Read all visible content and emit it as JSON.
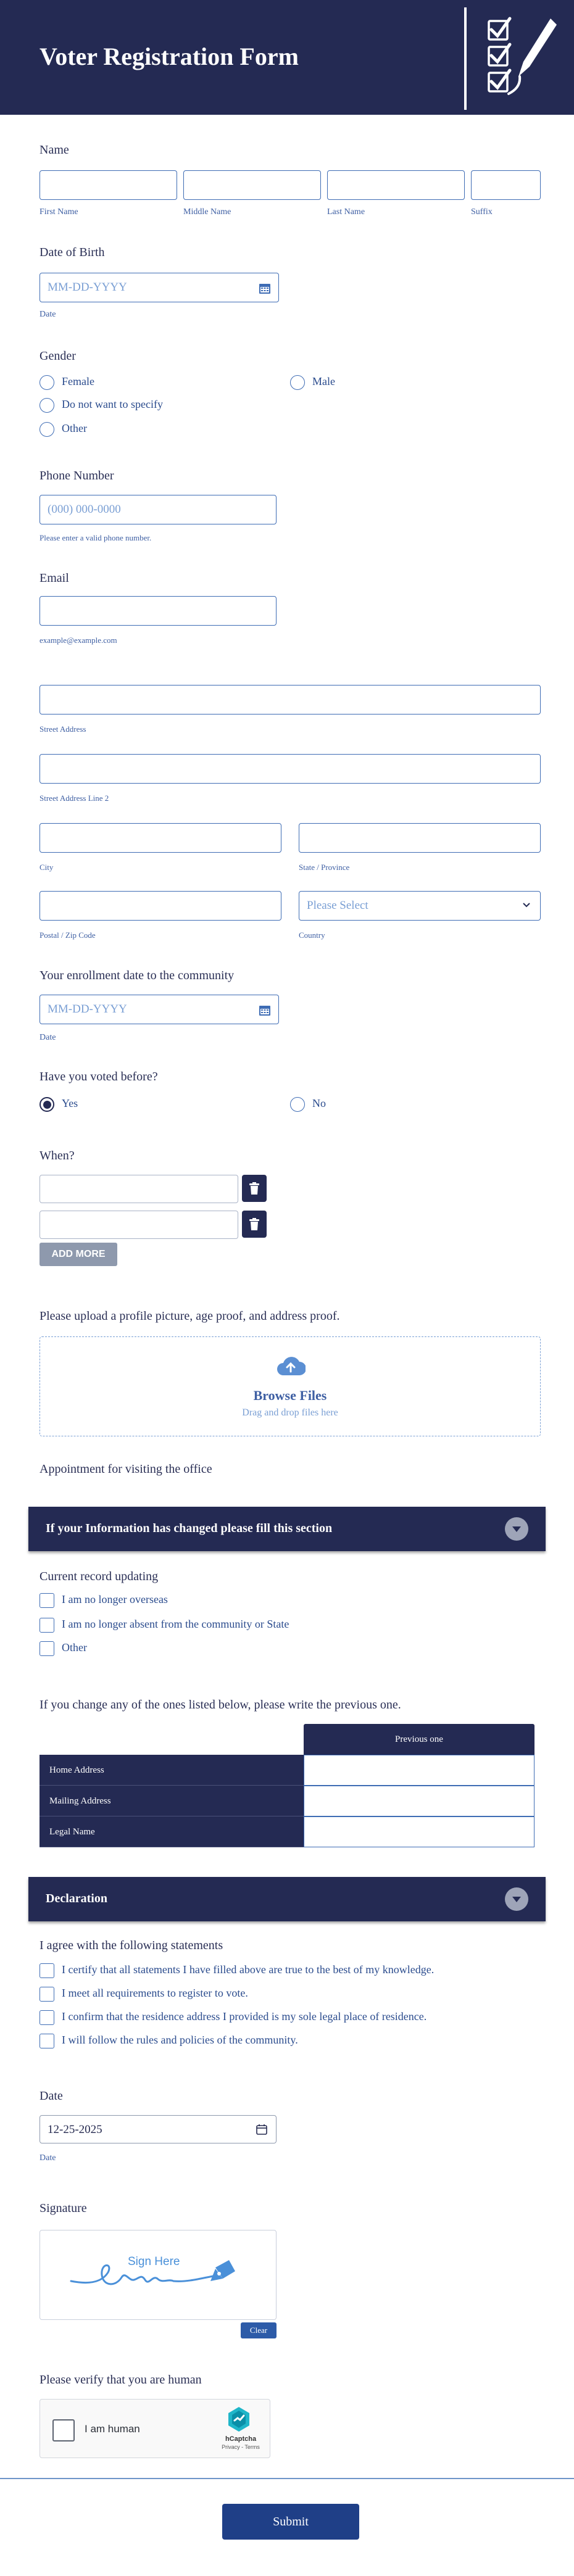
{
  "header": {
    "title": "Voter Registration Form",
    "logo": "checklist-pen-icon"
  },
  "name": {
    "label": "Name",
    "first": "First Name",
    "middle": "Middle Name",
    "last": "Last Name",
    "suffix": "Suffix"
  },
  "dob": {
    "label": "Date of Birth",
    "placeholder": "MM-DD-YYYY",
    "sublabel": "Date"
  },
  "gender": {
    "label": "Gender",
    "options": [
      "Female",
      "Male",
      "Do not want to specify",
      "Other"
    ]
  },
  "phone": {
    "label": "Phone Number",
    "placeholder": "(000) 000-0000",
    "sublabel": "Please enter a valid phone number."
  },
  "email": {
    "label": "Email",
    "sublabel": "example@example.com"
  },
  "address": {
    "street": "Street Address",
    "street2": "Street Address Line 2",
    "city": "City",
    "state": "State / Province",
    "postal": "Postal / Zip Code",
    "country": "Country",
    "country_placeholder": "Please Select"
  },
  "enrollment": {
    "label": "Your enrollment date to the community",
    "placeholder": "MM-DD-YYYY",
    "sublabel": "Date"
  },
  "voted": {
    "label": "Have you voted before?",
    "options": [
      "Yes",
      "No"
    ],
    "selected": "Yes"
  },
  "when": {
    "label": "When?",
    "add_more": "ADD MORE"
  },
  "upload": {
    "label": "Please upload a profile picture, age proof, and address proof.",
    "browse": "Browse Files",
    "hint": "Drag and drop files here"
  },
  "appointment": {
    "label": "Appointment for visiting the office"
  },
  "changed_section": {
    "title": "If your Information has changed please fill this section",
    "record_label": "Current record updating",
    "record_options": [
      "I am no longer overseas",
      "I am no longer absent from the community or State",
      "Other"
    ],
    "change_label": "If you change any of the ones listed below, please write the previous one.",
    "column": "Previous one",
    "rows": [
      "Home Address",
      "Mailing Address",
      "Legal Name"
    ]
  },
  "declaration": {
    "title": "Declaration",
    "statements_label": "I agree with the following statements",
    "statements": [
      "I certify that all statements I have filled above are true to the best of my knowledge.",
      "I meet all requirements to register to vote.",
      "I confirm that the residence address I provided is my sole legal place of residence.",
      "I will follow the rules and policies of the community."
    ]
  },
  "date": {
    "label": "Date",
    "value": "12-25-2025",
    "sublabel": "Date"
  },
  "signature": {
    "label": "Signature",
    "hint": "Sign Here",
    "clear": "Clear"
  },
  "captcha": {
    "label": "Please verify that you are human",
    "text": "I am human",
    "brand": "hCaptcha",
    "links": "Privacy - Terms"
  },
  "submit": {
    "label": "Submit"
  },
  "colors": {
    "navy": "#242a53",
    "accent": "#3e6cb4",
    "submit": "#1f3f87"
  }
}
